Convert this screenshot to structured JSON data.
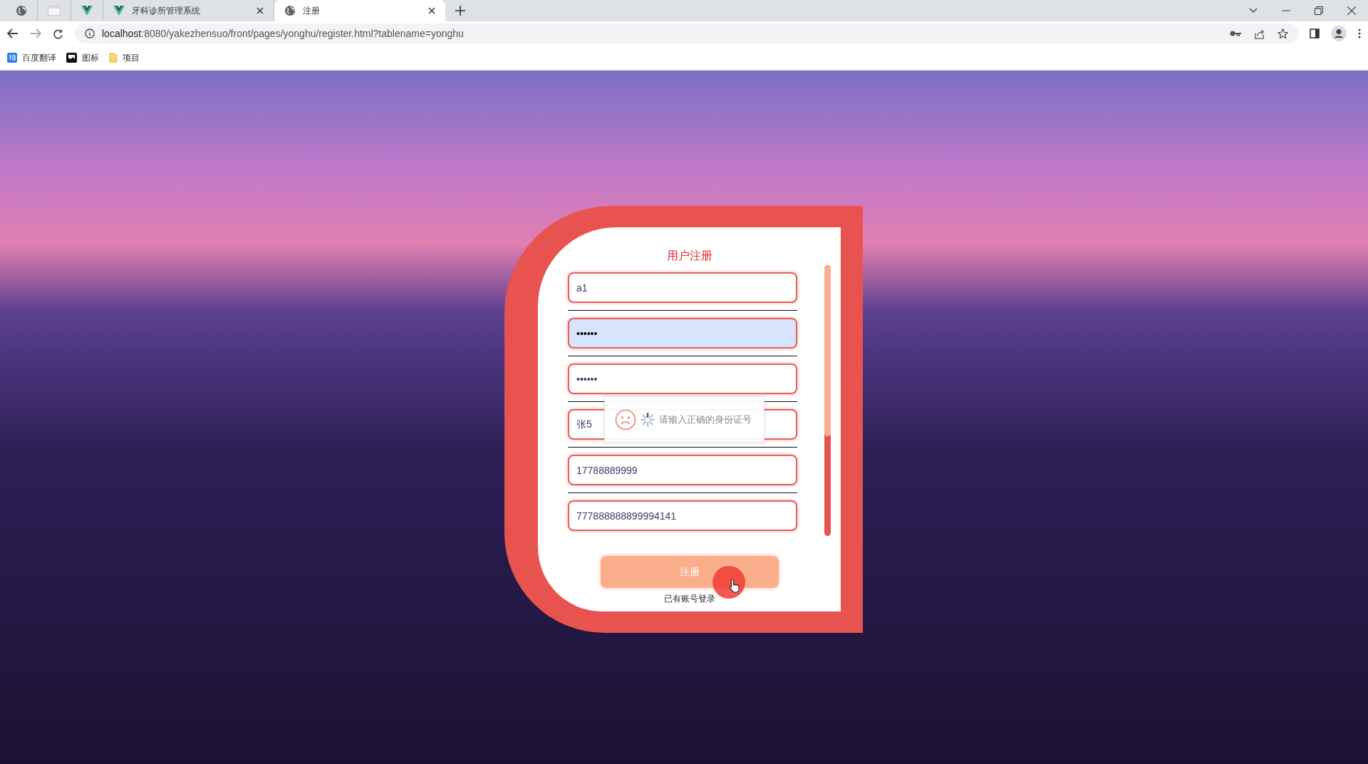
{
  "browser": {
    "tabs": [
      {
        "selected": false
      },
      {
        "selected": false
      },
      {
        "selected": false
      },
      {
        "title": "牙科诊所管理系统",
        "selected": false
      },
      {
        "title": "注册",
        "selected": true
      }
    ],
    "address": {
      "host": "localhost",
      "rest": ":8080/yakezhensuo/front/pages/yonghu/register.html?tablename=yonghu"
    },
    "bookmarks": [
      {
        "label": "百度翻译"
      },
      {
        "label": "图标"
      },
      {
        "label": "项目"
      }
    ]
  },
  "form": {
    "title": "用户注册",
    "fields": [
      {
        "value": "a1",
        "autofilled": false
      },
      {
        "value": "••••••",
        "autofilled": true
      },
      {
        "value": "••••••",
        "autofilled": false
      },
      {
        "value": "张5",
        "autofilled": false
      },
      {
        "value": "17788889999",
        "autofilled": false
      },
      {
        "value": "777888888899994141",
        "autofilled": false
      }
    ],
    "submit": "注册",
    "login_link": "已有账号登录"
  },
  "toast": {
    "message": "请输入正确的身份证号"
  }
}
